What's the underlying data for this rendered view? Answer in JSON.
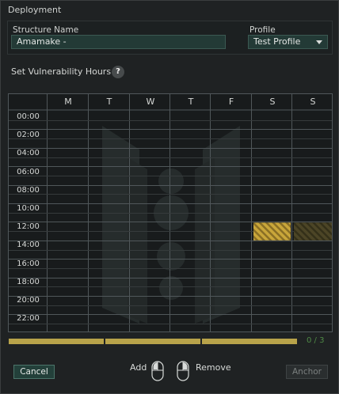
{
  "window": {
    "title": "Deployment"
  },
  "form": {
    "structure_name_label": "Structure Name",
    "structure_name_value": "Amamake -",
    "profile_label": "Profile",
    "profile_selected": "Test Profile"
  },
  "vulnerability": {
    "label": "Set Vulnerability Hours",
    "help_symbol": "?"
  },
  "schedule": {
    "days": [
      "M",
      "T",
      "W",
      "T",
      "F",
      "S",
      "S"
    ],
    "hours": [
      "00:00",
      "02:00",
      "04:00",
      "06:00",
      "08:00",
      "10:00",
      "12:00",
      "14:00",
      "16:00",
      "18:00",
      "20:00",
      "22:00"
    ],
    "selected": [
      {
        "day_index": 5,
        "hour_start": 12,
        "hour_end": 14,
        "state": "selected"
      },
      {
        "day_index": 6,
        "hour_start": 12,
        "hour_end": 14,
        "state": "dimmed"
      }
    ]
  },
  "progress": {
    "segments_filled": 3,
    "segments_total": 3,
    "count_text": "0 / 3"
  },
  "controls": {
    "add_label": "Add",
    "remove_label": "Remove",
    "cancel_label": "Cancel",
    "anchor_label": "Anchor"
  },
  "colors": {
    "accent_yellow": "#e0c24a",
    "input_bg": "#233a36",
    "count_green": "#4f8a46"
  }
}
